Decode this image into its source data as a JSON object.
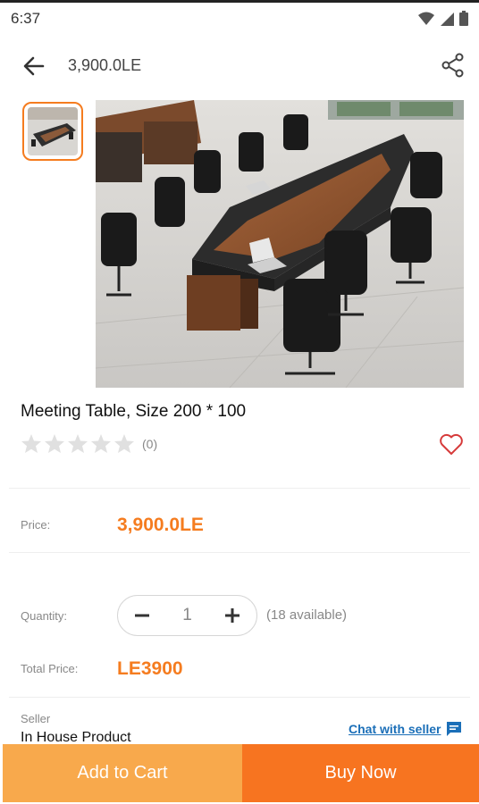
{
  "status_bar": {
    "time": "6:37"
  },
  "header": {
    "title": "3,900.0LE"
  },
  "product": {
    "name": "Meeting Table, Size 200 * 100",
    "rating_count": "(0)",
    "stars": 0
  },
  "price": {
    "label": "Price:",
    "value": "3,900.0LE"
  },
  "quantity": {
    "label": "Quantity:",
    "value": "1",
    "available": "(18 available)"
  },
  "total": {
    "label": "Total Price:",
    "value": "LE3900"
  },
  "seller": {
    "label": "Seller",
    "name": "In House Product",
    "chat_label": "Chat with seller"
  },
  "actions": {
    "add_to_cart": "Add to Cart",
    "buy_now": "Buy Now"
  },
  "colors": {
    "accent": "#f57c1f",
    "cart_button": "#f8a94c",
    "buy_button": "#f77420",
    "link": "#1b6fb8"
  },
  "icons": [
    "back-arrow-icon",
    "share-icon",
    "star-icon",
    "heart-icon",
    "minus-icon",
    "plus-icon",
    "chat-icon",
    "wifi-icon",
    "signal-icon",
    "battery-icon"
  ]
}
